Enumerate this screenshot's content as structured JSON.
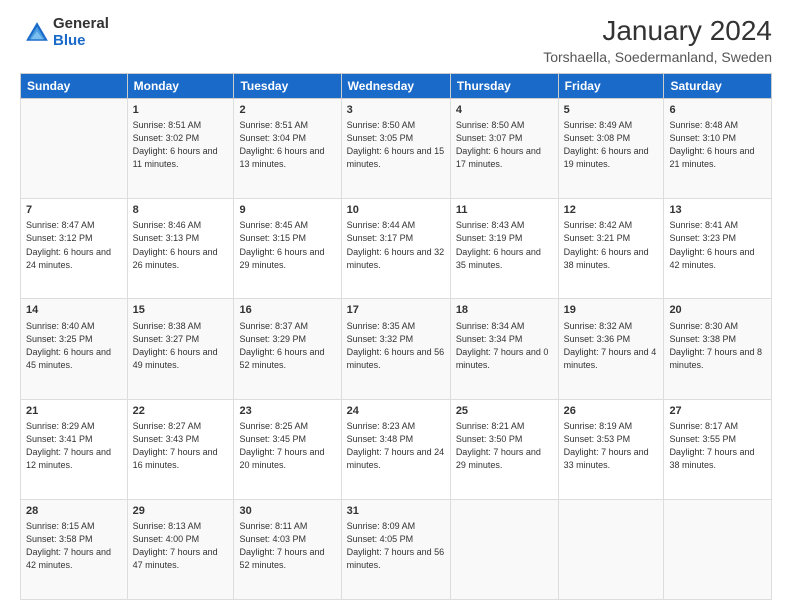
{
  "logo": {
    "general": "General",
    "blue": "Blue"
  },
  "header": {
    "title": "January 2024",
    "subtitle": "Torshaella, Soedermanland, Sweden"
  },
  "days_of_week": [
    "Sunday",
    "Monday",
    "Tuesday",
    "Wednesday",
    "Thursday",
    "Friday",
    "Saturday"
  ],
  "weeks": [
    [
      {
        "day": "",
        "sunrise": "",
        "sunset": "",
        "daylight": ""
      },
      {
        "day": "1",
        "sunrise": "Sunrise: 8:51 AM",
        "sunset": "Sunset: 3:02 PM",
        "daylight": "Daylight: 6 hours and 11 minutes."
      },
      {
        "day": "2",
        "sunrise": "Sunrise: 8:51 AM",
        "sunset": "Sunset: 3:04 PM",
        "daylight": "Daylight: 6 hours and 13 minutes."
      },
      {
        "day": "3",
        "sunrise": "Sunrise: 8:50 AM",
        "sunset": "Sunset: 3:05 PM",
        "daylight": "Daylight: 6 hours and 15 minutes."
      },
      {
        "day": "4",
        "sunrise": "Sunrise: 8:50 AM",
        "sunset": "Sunset: 3:07 PM",
        "daylight": "Daylight: 6 hours and 17 minutes."
      },
      {
        "day": "5",
        "sunrise": "Sunrise: 8:49 AM",
        "sunset": "Sunset: 3:08 PM",
        "daylight": "Daylight: 6 hours and 19 minutes."
      },
      {
        "day": "6",
        "sunrise": "Sunrise: 8:48 AM",
        "sunset": "Sunset: 3:10 PM",
        "daylight": "Daylight: 6 hours and 21 minutes."
      }
    ],
    [
      {
        "day": "7",
        "sunrise": "Sunrise: 8:47 AM",
        "sunset": "Sunset: 3:12 PM",
        "daylight": "Daylight: 6 hours and 24 minutes."
      },
      {
        "day": "8",
        "sunrise": "Sunrise: 8:46 AM",
        "sunset": "Sunset: 3:13 PM",
        "daylight": "Daylight: 6 hours and 26 minutes."
      },
      {
        "day": "9",
        "sunrise": "Sunrise: 8:45 AM",
        "sunset": "Sunset: 3:15 PM",
        "daylight": "Daylight: 6 hours and 29 minutes."
      },
      {
        "day": "10",
        "sunrise": "Sunrise: 8:44 AM",
        "sunset": "Sunset: 3:17 PM",
        "daylight": "Daylight: 6 hours and 32 minutes."
      },
      {
        "day": "11",
        "sunrise": "Sunrise: 8:43 AM",
        "sunset": "Sunset: 3:19 PM",
        "daylight": "Daylight: 6 hours and 35 minutes."
      },
      {
        "day": "12",
        "sunrise": "Sunrise: 8:42 AM",
        "sunset": "Sunset: 3:21 PM",
        "daylight": "Daylight: 6 hours and 38 minutes."
      },
      {
        "day": "13",
        "sunrise": "Sunrise: 8:41 AM",
        "sunset": "Sunset: 3:23 PM",
        "daylight": "Daylight: 6 hours and 42 minutes."
      }
    ],
    [
      {
        "day": "14",
        "sunrise": "Sunrise: 8:40 AM",
        "sunset": "Sunset: 3:25 PM",
        "daylight": "Daylight: 6 hours and 45 minutes."
      },
      {
        "day": "15",
        "sunrise": "Sunrise: 8:38 AM",
        "sunset": "Sunset: 3:27 PM",
        "daylight": "Daylight: 6 hours and 49 minutes."
      },
      {
        "day": "16",
        "sunrise": "Sunrise: 8:37 AM",
        "sunset": "Sunset: 3:29 PM",
        "daylight": "Daylight: 6 hours and 52 minutes."
      },
      {
        "day": "17",
        "sunrise": "Sunrise: 8:35 AM",
        "sunset": "Sunset: 3:32 PM",
        "daylight": "Daylight: 6 hours and 56 minutes."
      },
      {
        "day": "18",
        "sunrise": "Sunrise: 8:34 AM",
        "sunset": "Sunset: 3:34 PM",
        "daylight": "Daylight: 7 hours and 0 minutes."
      },
      {
        "day": "19",
        "sunrise": "Sunrise: 8:32 AM",
        "sunset": "Sunset: 3:36 PM",
        "daylight": "Daylight: 7 hours and 4 minutes."
      },
      {
        "day": "20",
        "sunrise": "Sunrise: 8:30 AM",
        "sunset": "Sunset: 3:38 PM",
        "daylight": "Daylight: 7 hours and 8 minutes."
      }
    ],
    [
      {
        "day": "21",
        "sunrise": "Sunrise: 8:29 AM",
        "sunset": "Sunset: 3:41 PM",
        "daylight": "Daylight: 7 hours and 12 minutes."
      },
      {
        "day": "22",
        "sunrise": "Sunrise: 8:27 AM",
        "sunset": "Sunset: 3:43 PM",
        "daylight": "Daylight: 7 hours and 16 minutes."
      },
      {
        "day": "23",
        "sunrise": "Sunrise: 8:25 AM",
        "sunset": "Sunset: 3:45 PM",
        "daylight": "Daylight: 7 hours and 20 minutes."
      },
      {
        "day": "24",
        "sunrise": "Sunrise: 8:23 AM",
        "sunset": "Sunset: 3:48 PM",
        "daylight": "Daylight: 7 hours and 24 minutes."
      },
      {
        "day": "25",
        "sunrise": "Sunrise: 8:21 AM",
        "sunset": "Sunset: 3:50 PM",
        "daylight": "Daylight: 7 hours and 29 minutes."
      },
      {
        "day": "26",
        "sunrise": "Sunrise: 8:19 AM",
        "sunset": "Sunset: 3:53 PM",
        "daylight": "Daylight: 7 hours and 33 minutes."
      },
      {
        "day": "27",
        "sunrise": "Sunrise: 8:17 AM",
        "sunset": "Sunset: 3:55 PM",
        "daylight": "Daylight: 7 hours and 38 minutes."
      }
    ],
    [
      {
        "day": "28",
        "sunrise": "Sunrise: 8:15 AM",
        "sunset": "Sunset: 3:58 PM",
        "daylight": "Daylight: 7 hours and 42 minutes."
      },
      {
        "day": "29",
        "sunrise": "Sunrise: 8:13 AM",
        "sunset": "Sunset: 4:00 PM",
        "daylight": "Daylight: 7 hours and 47 minutes."
      },
      {
        "day": "30",
        "sunrise": "Sunrise: 8:11 AM",
        "sunset": "Sunset: 4:03 PM",
        "daylight": "Daylight: 7 hours and 52 minutes."
      },
      {
        "day": "31",
        "sunrise": "Sunrise: 8:09 AM",
        "sunset": "Sunset: 4:05 PM",
        "daylight": "Daylight: 7 hours and 56 minutes."
      },
      {
        "day": "",
        "sunrise": "",
        "sunset": "",
        "daylight": ""
      },
      {
        "day": "",
        "sunrise": "",
        "sunset": "",
        "daylight": ""
      },
      {
        "day": "",
        "sunrise": "",
        "sunset": "",
        "daylight": ""
      }
    ]
  ]
}
